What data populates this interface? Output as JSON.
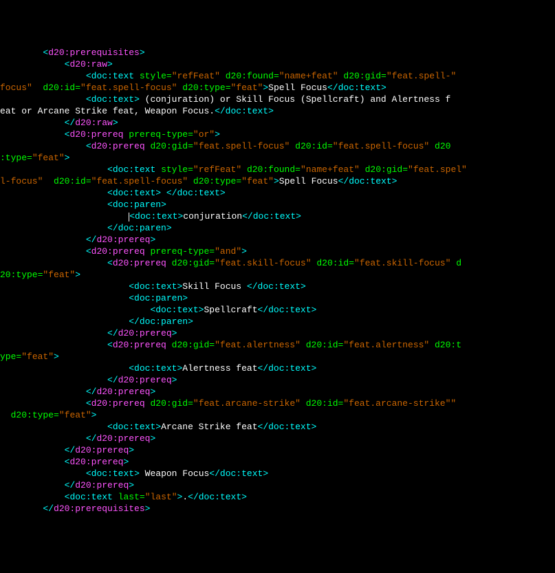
{
  "lines": [
    {
      "indent": 8,
      "type": "d20open",
      "tag": "d20:prerequisites",
      "attrs": []
    },
    {
      "indent": 12,
      "type": "d20open",
      "tag": "d20:raw",
      "attrs": []
    },
    {
      "indent": 16,
      "type": "docseg",
      "segments": [
        {
          "t": "open",
          "tag": "doc:text",
          "attrs": [
            [
              "style",
              "refFeat"
            ],
            [
              "d20:found",
              "name+feat"
            ],
            [
              "d20:gid",
              "feat.spell-"
            ]
          ]
        }
      ]
    },
    {
      "indent": 0,
      "type": "wrap",
      "segments": [
        {
          "t": "contattr",
          "text": "focus\" "
        },
        {
          "t": "attrs",
          "attrs": [
            [
              "d20:id",
              "feat.spell-focus"
            ],
            [
              "d20:type",
              "feat"
            ]
          ]
        },
        {
          "t": "closebr"
        },
        {
          "t": "text",
          "text": "Spell Focus"
        },
        {
          "t": "closeTag",
          "tag": "doc:text"
        }
      ]
    },
    {
      "indent": 16,
      "type": "docseg",
      "segments": [
        {
          "t": "open",
          "tag": "doc:text",
          "attrs": []
        },
        {
          "t": "closebr"
        },
        {
          "t": "text",
          "text": " (conjuration) or Skill Focus (Spellcraft) and Alertness f"
        }
      ]
    },
    {
      "indent": 0,
      "type": "wrap",
      "segments": [
        {
          "t": "text",
          "text": "eat or Arcane Strike feat, Weapon Focus."
        },
        {
          "t": "closeTag",
          "tag": "doc:text"
        }
      ]
    },
    {
      "indent": 12,
      "type": "d20close",
      "tag": "d20:raw"
    },
    {
      "indent": 12,
      "type": "d20open",
      "tag": "d20:prereq",
      "attrs": [
        [
          "prereq-type",
          "or"
        ]
      ]
    },
    {
      "indent": 16,
      "type": "d20openwrap",
      "tag": "d20:prereq",
      "attrs": [
        [
          "d20:gid",
          "feat.spell-focus"
        ],
        [
          "d20:id",
          "feat.spell-focus"
        ],
        [
          "d20"
        ]
      ]
    },
    {
      "indent": 0,
      "type": "wrap",
      "segments": [
        {
          "t": "contattr2",
          "name": ":type=",
          "val": "feat"
        },
        {
          "t": "closebr"
        }
      ]
    },
    {
      "indent": 20,
      "type": "docseg",
      "segments": [
        {
          "t": "open",
          "tag": "doc:text",
          "attrs": [
            [
              "style",
              "refFeat"
            ],
            [
              "d20:found",
              "name+feat"
            ],
            [
              "d20:gid",
              "feat.spel"
            ]
          ]
        }
      ]
    },
    {
      "indent": 0,
      "type": "wrap",
      "segments": [
        {
          "t": "contattr",
          "text": "l-focus\" "
        },
        {
          "t": "attrs",
          "attrs": [
            [
              "d20:id",
              "feat.spell-focus"
            ],
            [
              "d20:type",
              "feat"
            ]
          ]
        },
        {
          "t": "closebr"
        },
        {
          "t": "text",
          "text": "Spell Focus"
        },
        {
          "t": "closeTag",
          "tag": "doc:text"
        }
      ]
    },
    {
      "indent": 20,
      "type": "docseg",
      "segments": [
        {
          "t": "open",
          "tag": "doc:text",
          "attrs": []
        },
        {
          "t": "closebr"
        },
        {
          "t": "text",
          "text": " "
        },
        {
          "t": "closeTag",
          "tag": "doc:text"
        }
      ]
    },
    {
      "indent": 20,
      "type": "docseg",
      "segments": [
        {
          "t": "open",
          "tag": "doc:paren",
          "attrs": []
        },
        {
          "t": "closebr"
        }
      ]
    },
    {
      "indent": 24,
      "type": "docseg",
      "cursor": true,
      "segments": [
        {
          "t": "open",
          "tag": "doc:text",
          "attrs": []
        },
        {
          "t": "closebr"
        },
        {
          "t": "text",
          "text": "conjuration"
        },
        {
          "t": "closeTag",
          "tag": "doc:text"
        }
      ]
    },
    {
      "indent": 20,
      "type": "docclose",
      "tag": "doc:paren"
    },
    {
      "indent": 16,
      "type": "d20close",
      "tag": "d20:prereq"
    },
    {
      "indent": 16,
      "type": "d20open",
      "tag": "d20:prereq",
      "attrs": [
        [
          "prereq-type",
          "and"
        ]
      ]
    },
    {
      "indent": 20,
      "type": "d20openwrap",
      "tag": "d20:prereq",
      "attrs": [
        [
          "d20:gid",
          "feat.skill-focus"
        ],
        [
          "d20:id",
          "feat.skill-focus"
        ],
        [
          "d"
        ]
      ]
    },
    {
      "indent": 0,
      "type": "wrap",
      "segments": [
        {
          "t": "contattr2",
          "name": "20:type=",
          "val": "feat"
        },
        {
          "t": "closebr"
        }
      ]
    },
    {
      "indent": 24,
      "type": "docseg",
      "segments": [
        {
          "t": "open",
          "tag": "doc:text",
          "attrs": []
        },
        {
          "t": "closebr"
        },
        {
          "t": "text",
          "text": "Skill Focus "
        },
        {
          "t": "closeTag",
          "tag": "doc:text"
        }
      ]
    },
    {
      "indent": 24,
      "type": "docseg",
      "segments": [
        {
          "t": "open",
          "tag": "doc:paren",
          "attrs": []
        },
        {
          "t": "closebr"
        }
      ]
    },
    {
      "indent": 28,
      "type": "docseg",
      "segments": [
        {
          "t": "open",
          "tag": "doc:text",
          "attrs": []
        },
        {
          "t": "closebr"
        },
        {
          "t": "text",
          "text": "Spellcraft"
        },
        {
          "t": "closeTag",
          "tag": "doc:text"
        }
      ]
    },
    {
      "indent": 24,
      "type": "docclose",
      "tag": "doc:paren"
    },
    {
      "indent": 20,
      "type": "d20close",
      "tag": "d20:prereq"
    },
    {
      "indent": 20,
      "type": "d20openwrap",
      "tag": "d20:prereq",
      "attrs": [
        [
          "d20:gid",
          "feat.alertness"
        ],
        [
          "d20:id",
          "feat.alertness"
        ],
        [
          "d20:t"
        ]
      ]
    },
    {
      "indent": 0,
      "type": "wrap",
      "segments": [
        {
          "t": "contattr2",
          "name": "ype=",
          "val": "feat"
        },
        {
          "t": "closebr"
        }
      ]
    },
    {
      "indent": 24,
      "type": "docseg",
      "segments": [
        {
          "t": "open",
          "tag": "doc:text",
          "attrs": []
        },
        {
          "t": "closebr"
        },
        {
          "t": "text",
          "text": "Alertness feat"
        },
        {
          "t": "closeTag",
          "tag": "doc:text"
        }
      ]
    },
    {
      "indent": 20,
      "type": "d20close",
      "tag": "d20:prereq"
    },
    {
      "indent": 16,
      "type": "d20close",
      "tag": "d20:prereq"
    },
    {
      "indent": 16,
      "type": "d20openwrap",
      "tag": "d20:prereq",
      "attrs": [
        [
          "d20:gid",
          "feat.arcane-strike"
        ],
        [
          "d20:id",
          "feat.arcane-strike\""
        ]
      ]
    },
    {
      "indent": 0,
      "type": "wrap",
      "segments": [
        {
          "t": "rawattr",
          "text": " "
        },
        {
          "t": "attrs",
          "attrs": [
            [
              "d20:type",
              "feat"
            ]
          ]
        },
        {
          "t": "closebr"
        }
      ]
    },
    {
      "indent": 20,
      "type": "docseg",
      "segments": [
        {
          "t": "open",
          "tag": "doc:text",
          "attrs": []
        },
        {
          "t": "closebr"
        },
        {
          "t": "text",
          "text": "Arcane Strike feat"
        },
        {
          "t": "closeTag",
          "tag": "doc:text"
        }
      ]
    },
    {
      "indent": 16,
      "type": "d20close",
      "tag": "d20:prereq"
    },
    {
      "indent": 12,
      "type": "d20close",
      "tag": "d20:prereq"
    },
    {
      "indent": 12,
      "type": "d20open",
      "tag": "d20:prereq",
      "attrs": []
    },
    {
      "indent": 16,
      "type": "docseg",
      "segments": [
        {
          "t": "open",
          "tag": "doc:text",
          "attrs": []
        },
        {
          "t": "closebr"
        },
        {
          "t": "text",
          "text": " Weapon Focus"
        },
        {
          "t": "closeTag",
          "tag": "doc:text"
        }
      ]
    },
    {
      "indent": 12,
      "type": "d20close",
      "tag": "d20:prereq"
    },
    {
      "indent": 12,
      "type": "docseg",
      "segments": [
        {
          "t": "open",
          "tag": "doc:text",
          "attrs": [
            [
              "last",
              "last"
            ]
          ]
        },
        {
          "t": "closebr"
        },
        {
          "t": "text",
          "text": "."
        },
        {
          "t": "closeTag",
          "tag": "doc:text"
        }
      ]
    },
    {
      "indent": 8,
      "type": "d20close",
      "tag": "d20:prerequisites"
    }
  ]
}
